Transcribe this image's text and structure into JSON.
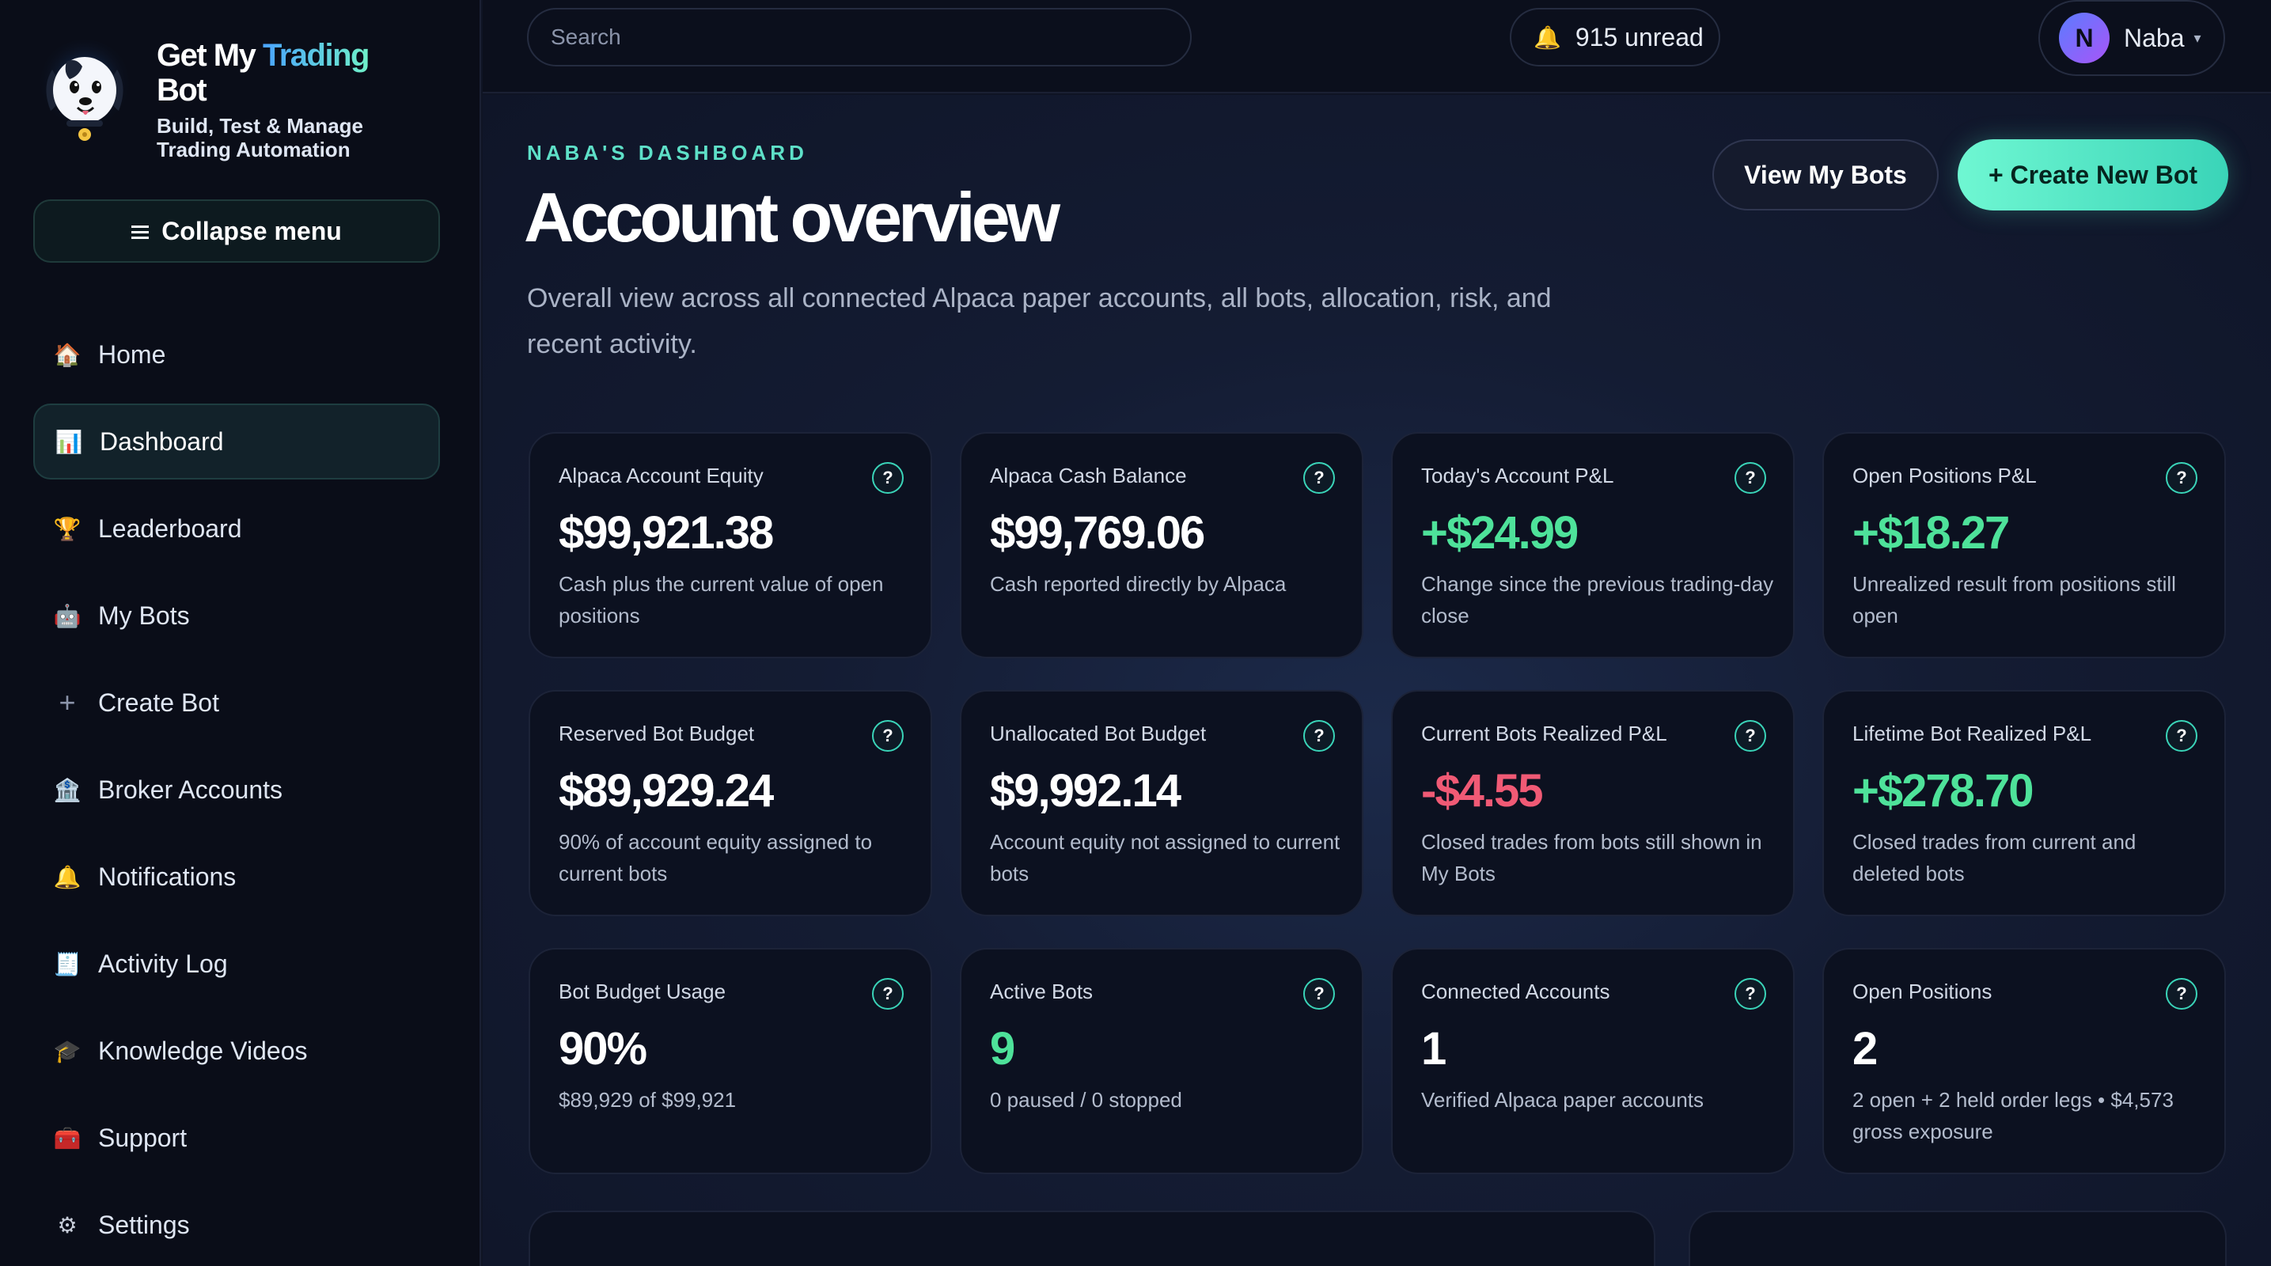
{
  "brand": {
    "title_part1": "Get My ",
    "title_part2": "Trading",
    "title_part3": "Bot",
    "subtitle_line1": "Build, Test & Manage",
    "subtitle_line2": "Trading Automation"
  },
  "sidebar": {
    "collapse_label": "Collapse menu",
    "items": [
      {
        "label": "Home",
        "icon": "house-icon",
        "glyph": "🏠"
      },
      {
        "label": "Dashboard",
        "icon": "chart-icon",
        "glyph": "📊",
        "active": true
      },
      {
        "label": "Leaderboard",
        "icon": "trophy-icon",
        "glyph": "🏆"
      },
      {
        "label": "My Bots",
        "icon": "robot-icon",
        "glyph": "🤖"
      },
      {
        "label": "Create Bot",
        "icon": "plus-icon",
        "glyph": "+"
      },
      {
        "label": "Broker Accounts",
        "icon": "bank-icon",
        "glyph": "🏦"
      },
      {
        "label": "Notifications",
        "icon": "bell-icon",
        "glyph": "🔔"
      },
      {
        "label": "Activity Log",
        "icon": "receipt-icon",
        "glyph": "🧾"
      },
      {
        "label": "Knowledge Videos",
        "icon": "graduation-cap-icon",
        "glyph": "🎓"
      },
      {
        "label": "Support",
        "icon": "toolbox-icon",
        "glyph": "🧰"
      },
      {
        "label": "Settings",
        "icon": "gear-icon",
        "glyph": "⚙"
      }
    ]
  },
  "topbar": {
    "search_placeholder": "Search",
    "notifications": "915 unread",
    "user_initial": "N",
    "user_name": "Naba"
  },
  "header": {
    "eyebrow": "NABA'S DASHBOARD",
    "title": "Account overview",
    "description": "Overall view across all connected Alpaca paper accounts, all bots, allocation, risk, and recent activity.",
    "view_bots": "View My Bots",
    "create_bot": "+ Create New Bot"
  },
  "cards": [
    {
      "label": "Alpaca Account Equity",
      "value": "$99,921.38",
      "tone": "neutral",
      "desc": "Cash plus the current value of open positions"
    },
    {
      "label": "Alpaca Cash Balance",
      "value": "$99,769.06",
      "tone": "neutral",
      "desc": "Cash reported directly by Alpaca"
    },
    {
      "label": "Today's Account P&L",
      "value": "+$24.99",
      "tone": "pos",
      "desc": "Change since the previous trading-day close"
    },
    {
      "label": "Open Positions P&L",
      "value": "+$18.27",
      "tone": "pos",
      "desc": "Unrealized result from positions still open"
    },
    {
      "label": "Reserved Bot Budget",
      "value": "$89,929.24",
      "tone": "neutral",
      "desc": "90% of account equity assigned to current bots"
    },
    {
      "label": "Unallocated Bot Budget",
      "value": "$9,992.14",
      "tone": "neutral",
      "desc": "Account equity not assigned to current bots"
    },
    {
      "label": "Current Bots Realized P&L",
      "value": "-$4.55",
      "tone": "neg",
      "desc": "Closed trades from bots still shown in My Bots"
    },
    {
      "label": "Lifetime Bot Realized P&L",
      "value": "+$278.70",
      "tone": "pos",
      "desc": "Closed trades from current and deleted bots"
    },
    {
      "label": "Bot Budget Usage",
      "value": "90%",
      "tone": "neutral",
      "desc": "$89,929 of $99,921"
    },
    {
      "label": "Active Bots",
      "value": "9",
      "tone": "pos",
      "desc": "0 paused / 0 stopped"
    },
    {
      "label": "Connected Accounts",
      "value": "1",
      "tone": "neutral",
      "desc": "Verified Alpaca paper accounts"
    },
    {
      "label": "Open Positions",
      "value": "2",
      "tone": "neutral",
      "desc": "2 open + 2 held order legs • $4,573 gross exposure"
    }
  ],
  "help_glyph": "?",
  "colors": {
    "accent": "#5ee0c8",
    "positive": "#4ee29a",
    "negative": "#f05a75",
    "background": "#0f1424",
    "sidebar": "#0a0d18"
  }
}
